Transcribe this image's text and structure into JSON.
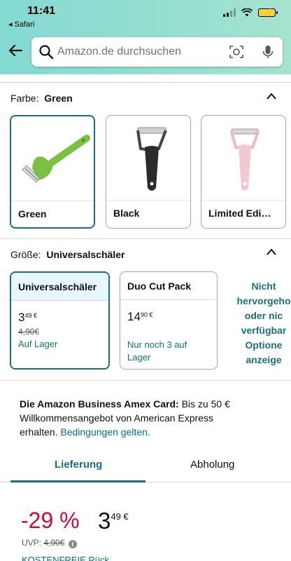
{
  "status_bar": {
    "time": "11:41",
    "back_app": "◂ Safari"
  },
  "search": {
    "placeholder": "Amazon.de durchsuchen"
  },
  "color_section": {
    "label": "Farbe:",
    "selected": "Green",
    "options": [
      {
        "label": "Green",
        "color": "#7bc043"
      },
      {
        "label": "Black",
        "color": "#2b2b2b"
      },
      {
        "label": "Limited Edi…",
        "color": "#f2c9cf"
      }
    ]
  },
  "size_section": {
    "label": "Größe:",
    "selected": "Universalschäler",
    "options": [
      {
        "name": "Universalschäler",
        "price_whole": "3",
        "price_fraction": "49 €",
        "old_price": "4,90€",
        "availability": "Auf Lager"
      },
      {
        "name": "Duo Cut Pack",
        "price_whole": "14",
        "price_fraction": "90 €",
        "availability_line1": "Nur noch 3 auf",
        "availability_line2": "Lager"
      }
    ],
    "not_shown": [
      "Nicht",
      "hervorgeho",
      "oder nic",
      "verfügbar",
      "Optione",
      "anzeige"
    ]
  },
  "amex": {
    "bold": "Die Amazon Business Amex Card:",
    "text": " Bis zu 50 € Willkommensangebot von American Express erhalten. ",
    "link": "Bedingungen gelten."
  },
  "tabs": {
    "delivery": "Lieferung",
    "pickup": "Abholung"
  },
  "offer": {
    "discount": "-29 %",
    "price_whole": "3",
    "price_fraction": "49 €",
    "uvp_label": "UVP:",
    "uvp_value": "4,90€",
    "free_delivery": "KOSTENFREIE Rück..."
  },
  "colors": {
    "accent": "#1a6f7a",
    "deal_red": "#cc0c39",
    "in_stock_green": "#067d62",
    "link": "#007185"
  }
}
